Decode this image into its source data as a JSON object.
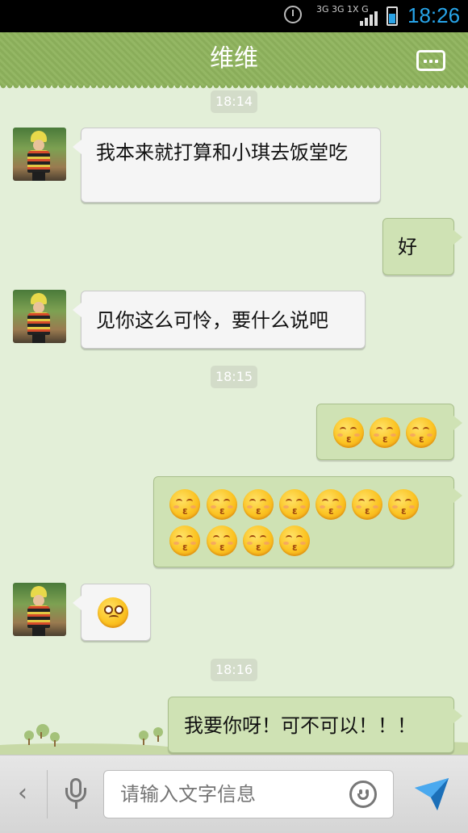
{
  "status_bar": {
    "network_top": "3G 3G 1X G",
    "time": "18:26"
  },
  "header": {
    "title": "维维"
  },
  "messages": [
    {
      "type": "time",
      "text": "18:14"
    },
    {
      "type": "received",
      "text": "我本来就打算和小琪去饭堂吃"
    },
    {
      "type": "sent",
      "text": "好"
    },
    {
      "type": "received",
      "text": "见你这么可怜，要什么说吧"
    },
    {
      "type": "time",
      "text": "18:15"
    },
    {
      "type": "sent",
      "emoji": "kiss-emoji",
      "count": 3
    },
    {
      "type": "sent",
      "emoji": "kiss-emoji",
      "count": 11
    },
    {
      "type": "received",
      "emoji": "thinking-emoji",
      "count": 1
    },
    {
      "type": "time",
      "text": "18:16"
    },
    {
      "type": "sent",
      "text": "我要你呀！可不可以！！！"
    }
  ],
  "input_bar": {
    "placeholder": "请输入文字信息"
  },
  "colors": {
    "header_green": "#8aad5a",
    "background": "#e3efd8",
    "sent_bubble": "#cfe2b4",
    "received_bubble": "#f5f5f5",
    "send_blue": "#2a8ee0"
  }
}
